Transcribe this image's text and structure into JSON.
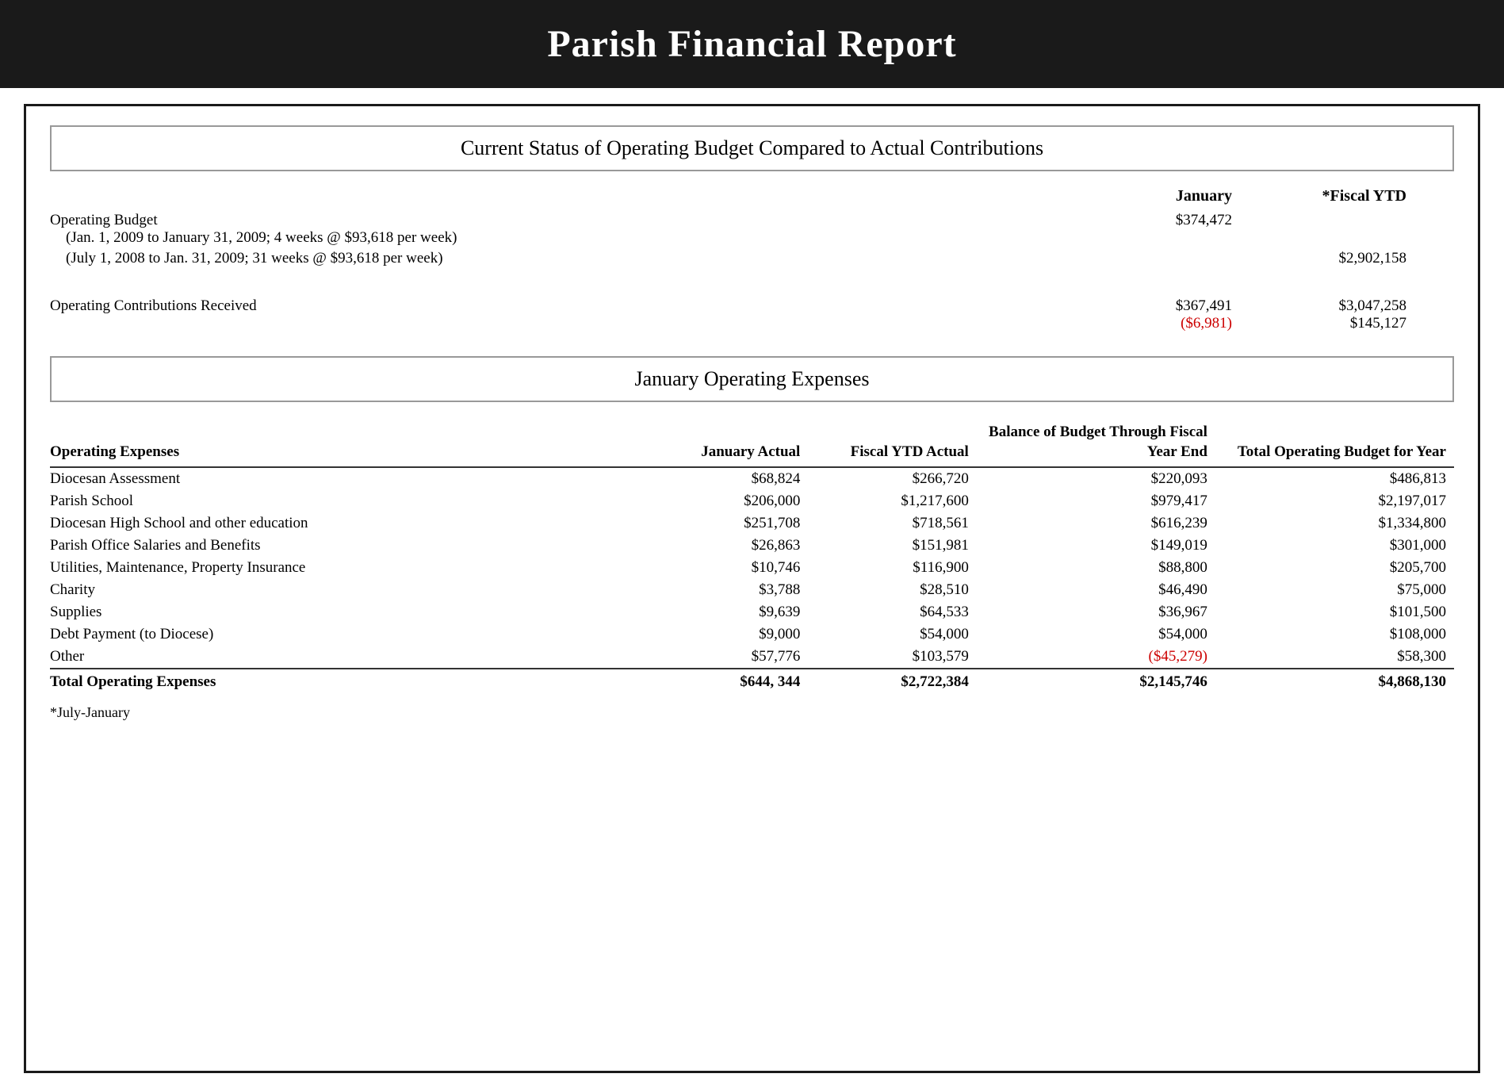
{
  "header": {
    "title": "Parish Financial Report"
  },
  "topSection": {
    "sectionTitle": "Current Status of Operating Budget Compared to Actual Contributions",
    "colHeaders": {
      "january": "January",
      "fiscalYTD": "*Fiscal YTD"
    },
    "operatingBudgetLabel": "Operating Budget",
    "budgetLine1": "(Jan. 1, 2009 to January 31, 2009; 4 weeks @ $93,618 per week)",
    "budgetLine1Jan": "$374,472",
    "budgetLine2": "(July 1, 2008 to Jan. 31, 2009; 31 weeks @ $93,618 per week)",
    "budgetLine2YTD": "$2,902,158",
    "contributionsLabel": "Operating Contributions Received",
    "contributionsJan": "$367,491",
    "contributionsJanDiff": "($6,981)",
    "contributionsYTD": "$3,047,258",
    "contributionsYTDDiff": "$145,127"
  },
  "expensesSection": {
    "sectionTitle": "January Operating Expenses",
    "tableHeaders": {
      "label": "Operating Expenses",
      "janActual": "January Actual",
      "fiscalYTD": "Fiscal YTD Actual",
      "balanceBudget": "Balance of Budget Through Fiscal Year End",
      "totalBudget": "Total Operating Budget for Year"
    },
    "rows": [
      {
        "label": "Diocesan Assessment",
        "janActual": "$68,824",
        "fiscalYTD": "$266,720",
        "balance": "$220,093",
        "total": "$486,813",
        "redBalance": false
      },
      {
        "label": "Parish School",
        "janActual": "$206,000",
        "fiscalYTD": "$1,217,600",
        "balance": "$979,417",
        "total": "$2,197,017",
        "redBalance": false
      },
      {
        "label": "Diocesan High School and other education",
        "janActual": "$251,708",
        "fiscalYTD": "$718,561",
        "balance": "$616,239",
        "total": "$1,334,800",
        "redBalance": false
      },
      {
        "label": "Parish Office Salaries and Benefits",
        "janActual": "$26,863",
        "fiscalYTD": "$151,981",
        "balance": "$149,019",
        "total": "$301,000",
        "redBalance": false
      },
      {
        "label": "Utilities, Maintenance, Property Insurance",
        "janActual": "$10,746",
        "fiscalYTD": "$116,900",
        "balance": "$88,800",
        "total": "$205,700",
        "redBalance": false
      },
      {
        "label": "Charity",
        "janActual": "$3,788",
        "fiscalYTD": "$28,510",
        "balance": "$46,490",
        "total": "$75,000",
        "redBalance": false
      },
      {
        "label": "Supplies",
        "janActual": "$9,639",
        "fiscalYTD": "$64,533",
        "balance": "$36,967",
        "total": "$101,500",
        "redBalance": false
      },
      {
        "label": "Debt Payment (to Diocese)",
        "janActual": "$9,000",
        "fiscalYTD": "$54,000",
        "balance": "$54,000",
        "total": "$108,000",
        "redBalance": false
      },
      {
        "label": "Other",
        "janActual": "$57,776",
        "fiscalYTD": "$103,579",
        "balance": "($45,279)",
        "total": "$58,300",
        "redBalance": true
      }
    ],
    "totalsRow": {
      "label": "Total Operating Expenses",
      "janActual": "$644, 344",
      "fiscalYTD": "$2,722,384",
      "balance": "$2,145,746",
      "total": "$4,868,130"
    },
    "footnote": "*July-January"
  }
}
